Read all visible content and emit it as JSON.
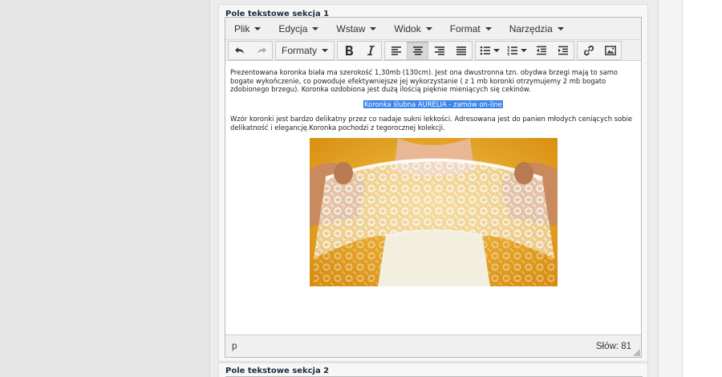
{
  "sections": [
    {
      "label": "Pole tekstowe sekcja 1"
    },
    {
      "label": "Pole tekstowe sekcja 2"
    }
  ],
  "menubar": {
    "items": [
      {
        "label": "Plik"
      },
      {
        "label": "Edycja"
      },
      {
        "label": "Wstaw"
      },
      {
        "label": "Widok"
      },
      {
        "label": "Format"
      },
      {
        "label": "Narzędzia"
      }
    ]
  },
  "toolbar": {
    "formats_label": "Formaty",
    "icons": [
      "undo-icon",
      "redo-icon",
      "bold-icon",
      "italic-icon",
      "align-left-icon",
      "align-center-icon",
      "align-right-icon",
      "align-justify-icon",
      "bullet-list-icon",
      "numbered-list-icon",
      "outdent-icon",
      "indent-icon",
      "link-icon",
      "image-icon"
    ],
    "active_button": "align-center"
  },
  "content": {
    "paragraph1": "Prezentowana koronka biała ma szerokość 1,30mb (130cm). Jest ona dwustronna tzn. obydwa brzegi mają to samo bogate wykończenie, co powoduje efektywniejsze jej wykorzystanie ( z 1 mb koronki otrzymujemy 2 mb bogato zdobionego brzegu). Koronka ozdobiona jest dużą ilością pięknie mieniących się cekinów.",
    "link_text": "Koronka ślubna AURELIA - zamów on-line",
    "paragraph2": "Wzór koronki jest bardzo delikatny przez co nadaje sukni lekkości. Adresowana jest do panien młodych ceniących sobie delikatność i elegancję.Koronka pochodzi z tegorocznej kolekcji."
  },
  "statusbar": {
    "path": "p",
    "word_count": "Słów: 81"
  },
  "colors": {
    "selection": "#3b84e8",
    "image_background": "#e6a21c",
    "section_label": "#1f2a44"
  }
}
